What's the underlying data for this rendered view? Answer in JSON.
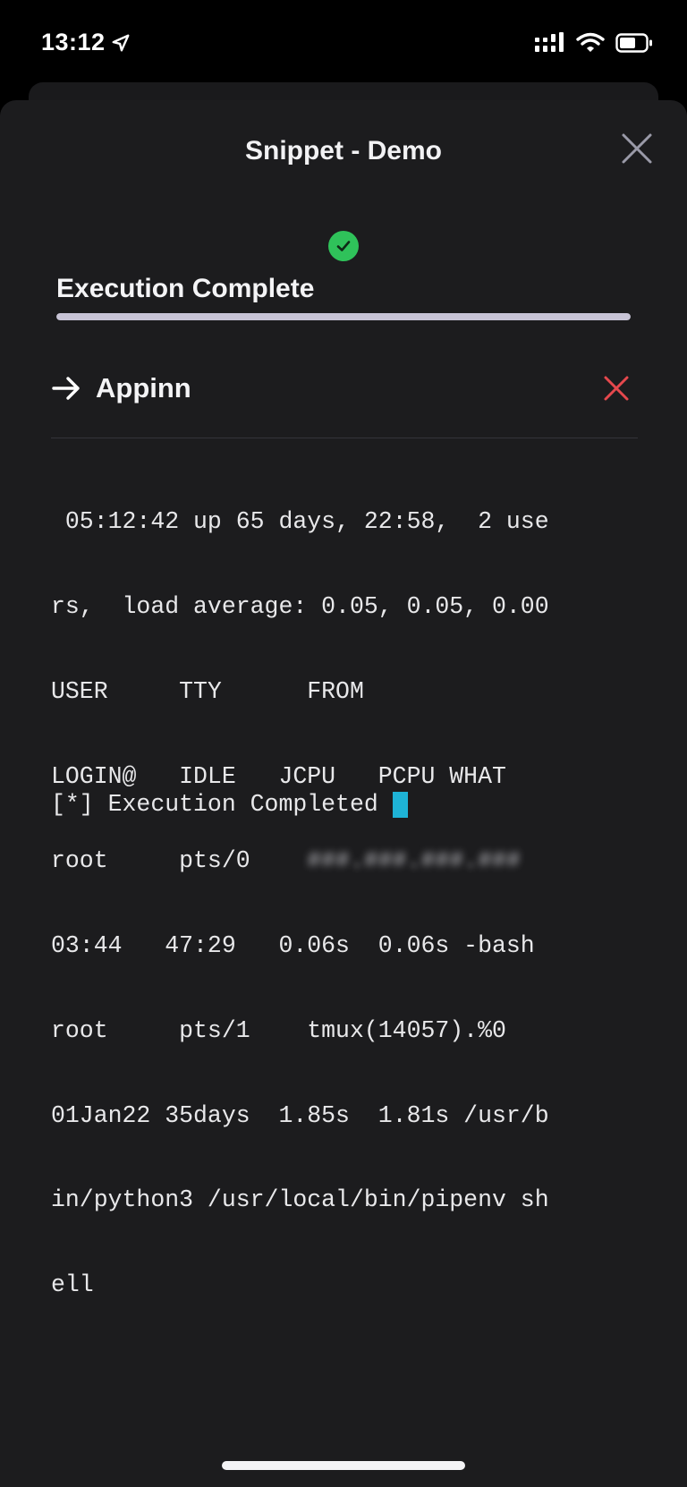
{
  "status_bar": {
    "time": "13:12",
    "location_icon": "location-arrow-icon",
    "signal_icon": "cellular-signal-icon",
    "wifi_icon": "wifi-icon",
    "battery_icon": "battery-icon"
  },
  "sheet": {
    "title": "Snippet - Demo",
    "close_icon": "close-icon"
  },
  "execution": {
    "status_icon": "check-circle-icon",
    "status_color": "#2fc25a",
    "title": "Execution Complete",
    "progress_percent": 100
  },
  "host": {
    "arrow_icon": "arrow-right-icon",
    "name": "Appinn",
    "remove_icon": "close-icon",
    "remove_color": "#e5484d"
  },
  "terminal": {
    "lines": [
      " 05:12:42 up 65 days, 22:58,  2 use",
      "rs,  load average: 0.05, 0.05, 0.00",
      "USER     TTY      FROM",
      "LOGIN@   IDLE   JCPU   PCPU WHAT",
      "root     pts/0    ",
      "03:44   47:29   0.06s  0.06s -bash",
      "root     pts/1    tmux(14057).%0",
      "01Jan22 35days  1.85s  1.81s /usr/b",
      "in/python3 /usr/local/bin/pipenv sh",
      "ell"
    ],
    "redacted_from": "###.###.###.###",
    "result": "[*] Execution Completed",
    "cursor_color": "#1eb3d6"
  }
}
